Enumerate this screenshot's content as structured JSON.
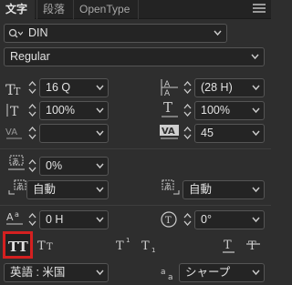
{
  "tabs": [
    {
      "label": "文字",
      "active": true
    },
    {
      "label": "段落",
      "active": false
    },
    {
      "label": "OpenType",
      "active": false
    }
  ],
  "font_family": "DIN",
  "font_style": "Regular",
  "font_size": "16 Q",
  "leading": "(28 H)",
  "vertical_scale": "100%",
  "horizontal_scale": "100%",
  "kerning": "",
  "tracking": "45",
  "tsume": "0%",
  "aki_before": "自動",
  "aki_after": "自動",
  "baseline_shift": "0 H",
  "rotation": "0°",
  "style_buttons": [
    "all-caps",
    "small-caps",
    "superscript",
    "subscript",
    "underline",
    "strikethrough"
  ],
  "language": "英語 : 米国",
  "antialias": "シャープ",
  "colors": {
    "accent_red": "#d42020"
  }
}
